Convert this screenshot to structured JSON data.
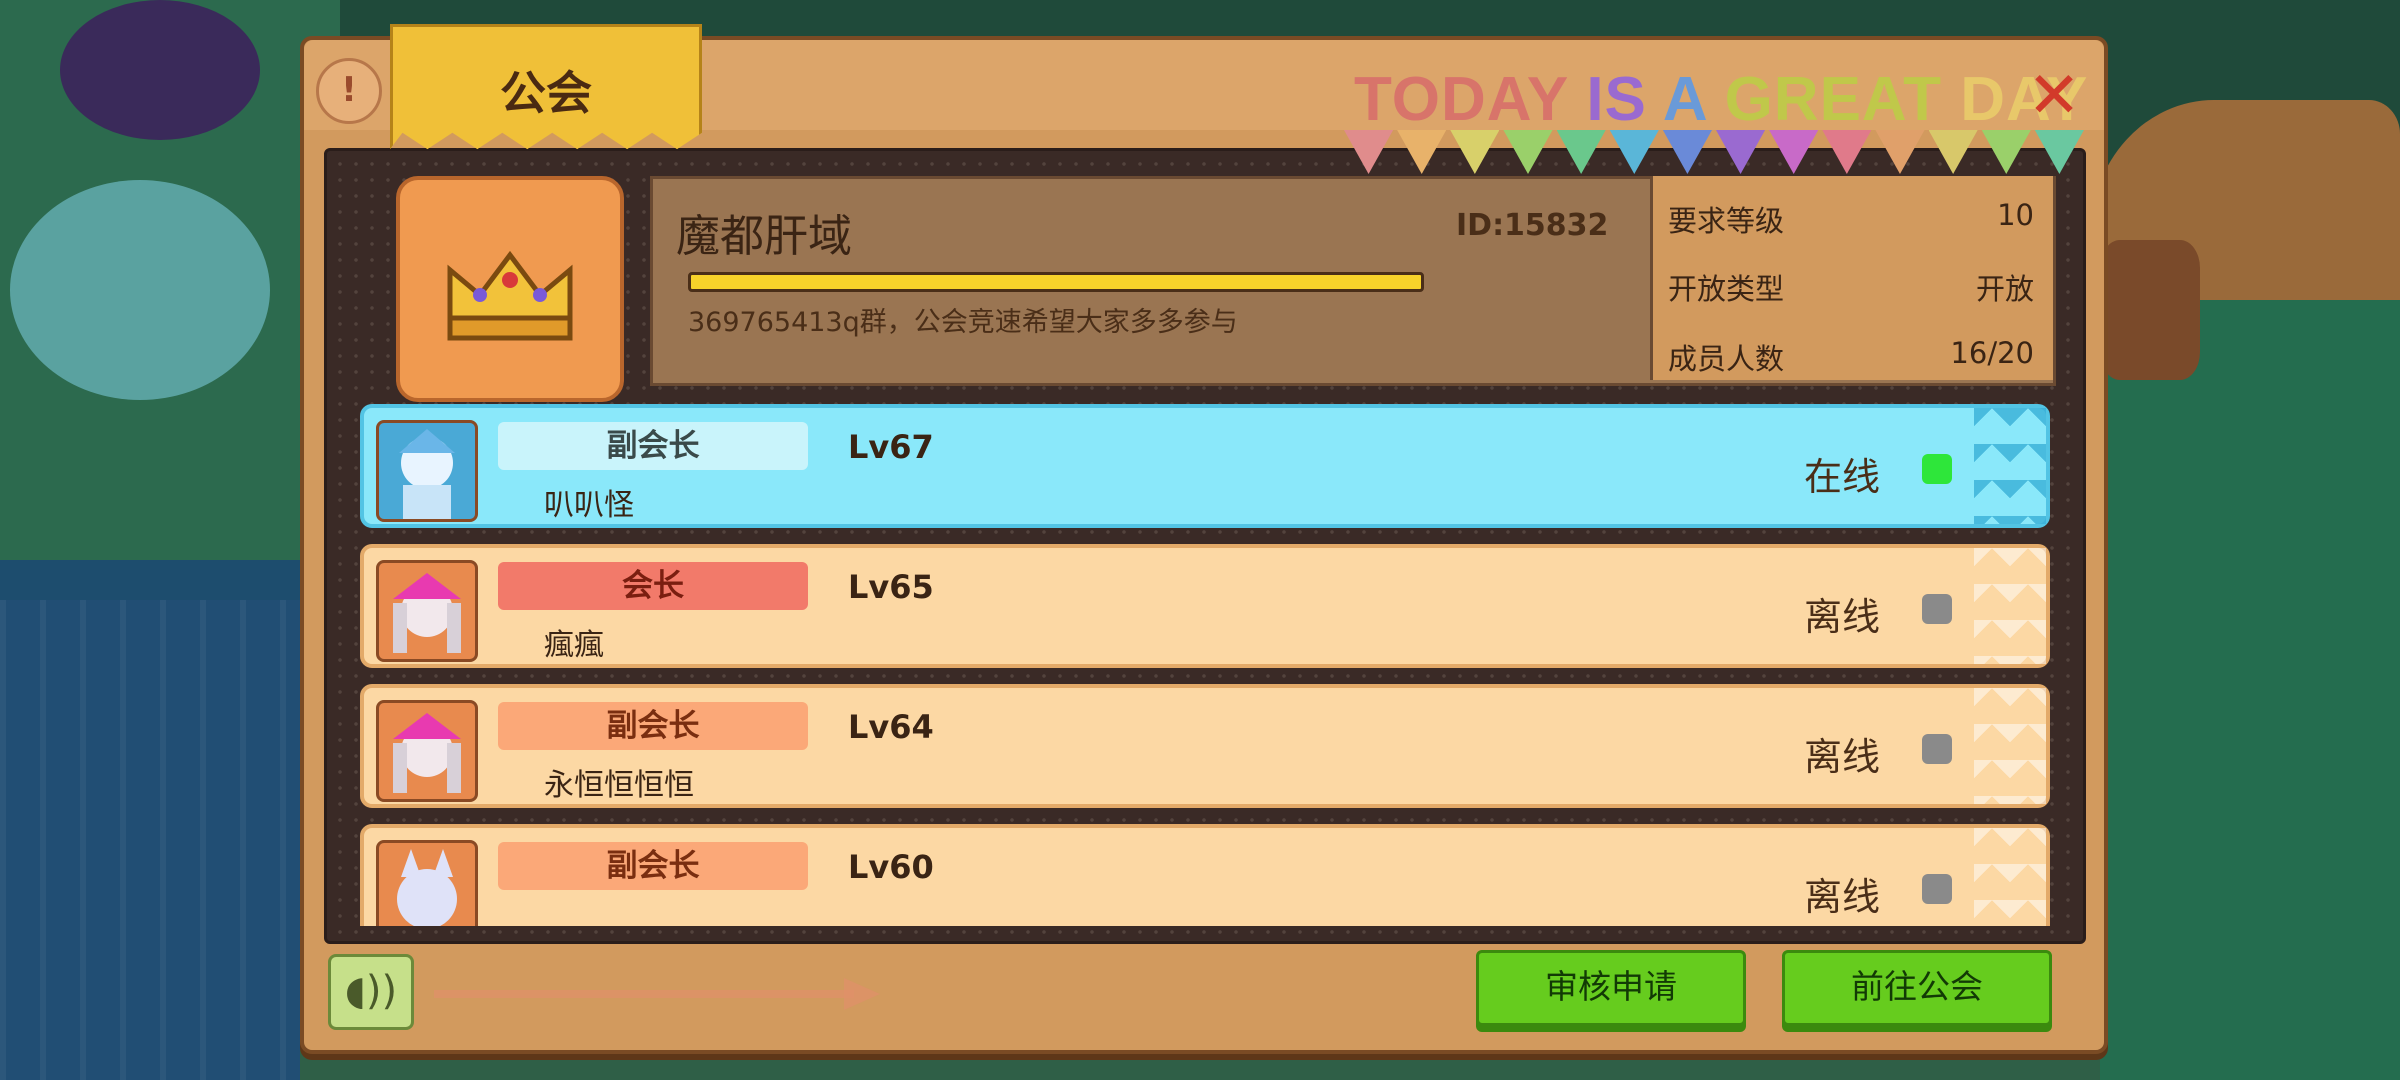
{
  "panel": {
    "title": "公会",
    "help_icon": "help-icon",
    "close_icon": "close-icon",
    "banner": [
      "TODAY",
      "IS",
      "A",
      "GREAT",
      "DAY"
    ],
    "banner_colors": [
      "#d8746a",
      "#9a6ad0",
      "#6a9ad8",
      "#c0c84a",
      "#e8c86a"
    ],
    "flag_colors": [
      "#e08c8c",
      "#e8b26a",
      "#d8d06a",
      "#9ad06a",
      "#6ac88c",
      "#5ab6d8",
      "#6a8ad8",
      "#9a6ad0",
      "#c86ac8",
      "#e07a8a",
      "#e0a06a",
      "#d8c86a",
      "#9ad06a",
      "#6ac8a0"
    ]
  },
  "guild": {
    "name": "魔都肝域",
    "id": "ID:15832",
    "description": "369765413q群，公会竞速希望大家多多参与",
    "stats": [
      {
        "label": "要求等级",
        "value": "10"
      },
      {
        "label": "开放类型",
        "value": "开放"
      },
      {
        "label": "成员人数",
        "value": "16/20"
      }
    ]
  },
  "members": [
    {
      "role": "副会长",
      "name": "叭叭怪",
      "level": "Lv67",
      "status": "在线",
      "online": true,
      "role_bg": "#c9f4fb",
      "role_color": "#3a4a4a",
      "dot": "#2ee63a"
    },
    {
      "role": "会长",
      "name": "瘋瘋",
      "level": "Lv65",
      "status": "离线",
      "online": false,
      "role_bg": "#f27a6a",
      "role_color": "#7a1e10",
      "dot": "#8a8a8a"
    },
    {
      "role": "副会长",
      "name": "永恒恒恒恒",
      "level": "Lv64",
      "status": "离线",
      "online": false,
      "role_bg": "#fba878",
      "role_color": "#7a2e10",
      "dot": "#8a8a8a"
    },
    {
      "role": "副会长",
      "name": "",
      "level": "Lv60",
      "status": "离线",
      "online": false,
      "role_bg": "#fba878",
      "role_color": "#7a2e10",
      "dot": "#8a8a8a"
    }
  ],
  "footer": {
    "voice_icon": "voice-icon",
    "review_label": "审核申请",
    "goto_label": "前往公会"
  }
}
